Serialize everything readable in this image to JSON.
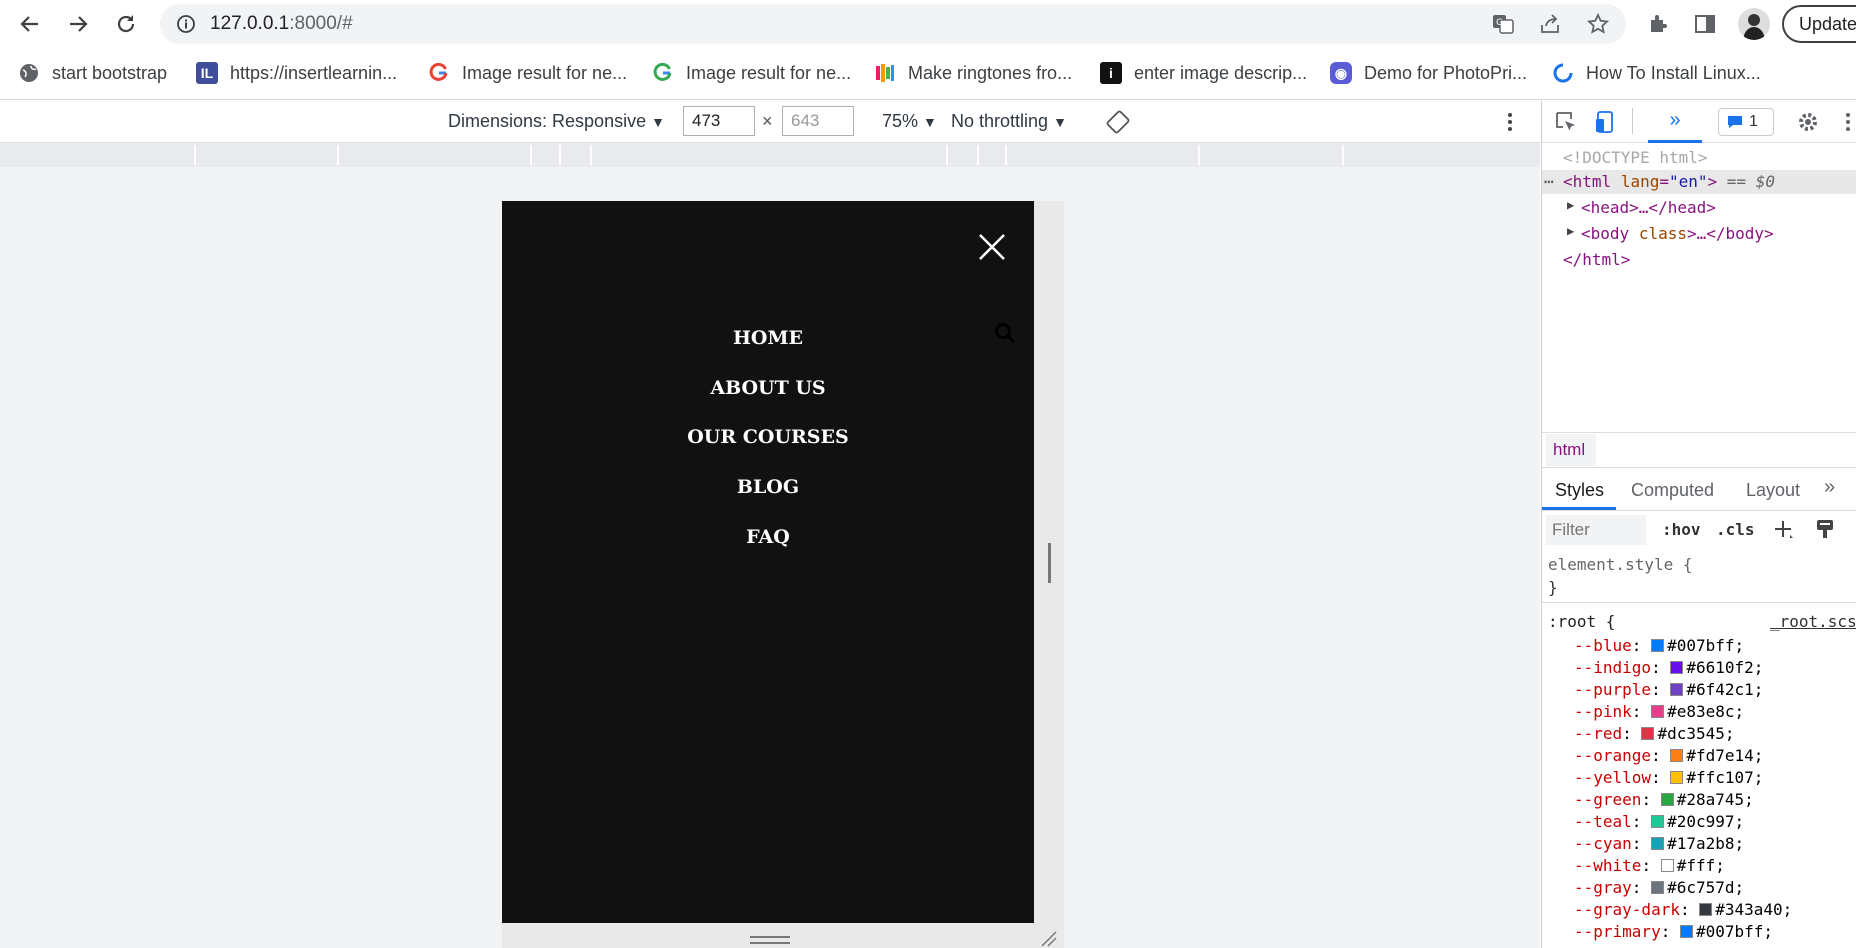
{
  "browser": {
    "url_host": "127.0.0.1",
    "url_rest": ":8000/#",
    "update_label": "Update"
  },
  "bookmarks": [
    {
      "label": "start bootstrap",
      "icon": "globe-icon"
    },
    {
      "label": "https://insertlearnin...",
      "icon": "il-logo-icon"
    },
    {
      "label": "Image result for ne...",
      "icon": "google-icon"
    },
    {
      "label": "Image result for ne...",
      "icon": "google-icon"
    },
    {
      "label": "Make ringtones fro...",
      "icon": "ringtone-icon"
    },
    {
      "label": "enter image descrip...",
      "icon": "info-icon"
    },
    {
      "label": "Demo for PhotoPri...",
      "icon": "photo-icon"
    },
    {
      "label": "How To Install Linux...",
      "icon": "loading-icon"
    }
  ],
  "device_toolbar": {
    "dimensions_label": "Dimensions: Responsive",
    "width": "473",
    "height": "643",
    "x_sep": "×",
    "zoom": "75%",
    "throttling": "No throttling"
  },
  "site_menu": {
    "items": [
      "HOME",
      "ABOUT US",
      "OUR COURSES",
      "BLOG",
      "FAQ"
    ]
  },
  "devtools": {
    "issues_count": "1",
    "doctype": "<!DOCTYPE html>",
    "html_open": "<html",
    "lang_attr": "lang",
    "lang_val": "\"en\"",
    "html_close_bracket": ">",
    "eq0": "== $0",
    "head": "<head>…</head>",
    "body_open": "<body",
    "body_attr": "class",
    "body_rest": ">…</body>",
    "html_end": "</html>",
    "breadcrumb": "html",
    "tabs": [
      "Styles",
      "Computed",
      "Layout"
    ],
    "filter_placeholder": "Filter",
    "hov": ":hov",
    "cls": ".cls",
    "element_style": "element.style {",
    "close_brace": "}",
    "root_selector": ":root {",
    "root_source": "_root.scss",
    "vars": [
      {
        "name": "--blue",
        "value": "#007bff;",
        "color": "#007bff"
      },
      {
        "name": "--indigo",
        "value": "#6610f2;",
        "color": "#6610f2"
      },
      {
        "name": "--purple",
        "value": "#6f42c1;",
        "color": "#6f42c1"
      },
      {
        "name": "--pink",
        "value": "#e83e8c;",
        "color": "#e83e8c"
      },
      {
        "name": "--red",
        "value": "#dc3545;",
        "color": "#dc3545"
      },
      {
        "name": "--orange",
        "value": "#fd7e14;",
        "color": "#fd7e14"
      },
      {
        "name": "--yellow",
        "value": "#ffc107;",
        "color": "#ffc107"
      },
      {
        "name": "--green",
        "value": "#28a745;",
        "color": "#28a745"
      },
      {
        "name": "--teal",
        "value": "#20c997;",
        "color": "#20c997"
      },
      {
        "name": "--cyan",
        "value": "#17a2b8;",
        "color": "#17a2b8"
      },
      {
        "name": "--white",
        "value": "#fff;",
        "color": "#ffffff"
      },
      {
        "name": "--gray",
        "value": "#6c757d;",
        "color": "#6c757d"
      },
      {
        "name": "--gray-dark",
        "value": "#343a40;",
        "color": "#343a40"
      },
      {
        "name": "--primary",
        "value": "#007bff;",
        "color": "#007bff"
      }
    ]
  }
}
